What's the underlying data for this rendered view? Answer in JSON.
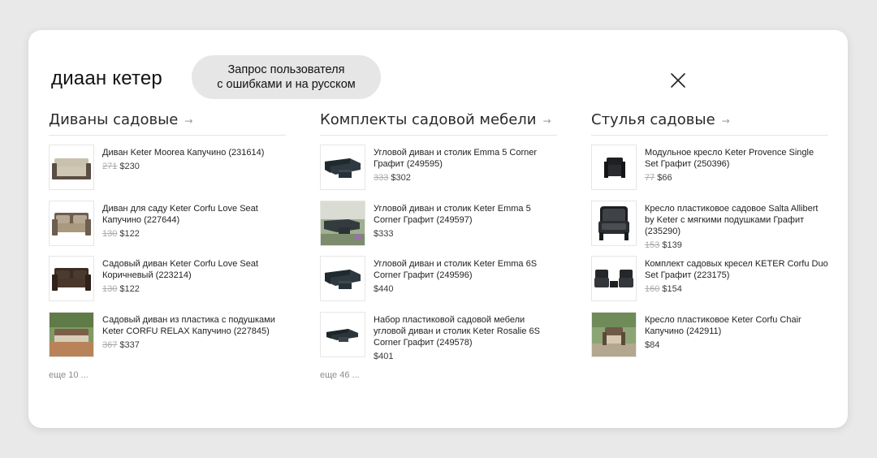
{
  "search": {
    "query": "диаан кетер"
  },
  "annotation": {
    "line1": "Запрос пользователя",
    "line2": "с ошибками и на русском"
  },
  "close_icon": "close-icon",
  "columns": [
    {
      "title": "Диваны садовые",
      "arrow": "→",
      "products": [
        {
          "name": "Диван Keter Moorea Капучино (231614)",
          "old_price": "271",
          "price": "$230",
          "image": "sofa-beige"
        },
        {
          "name": "Диван для саду Keter Corfu Love Seat Капучино (227644)",
          "old_price": "130",
          "price": "$122",
          "image": "sofa-cappuccino"
        },
        {
          "name": "Садовый диван Keter Corfu Love Seat Коричневый (223214)",
          "old_price": "130",
          "price": "$122",
          "image": "sofa-brown"
        },
        {
          "name": "Садовый диван из пластика с подушками Keter CORFU RELAX Капучино (227845)",
          "old_price": "367",
          "price": "$337",
          "image": "sofa-garden-scene"
        }
      ],
      "more": "еще 10 ..."
    },
    {
      "title": "Комплекты садовой мебели",
      "arrow": "→",
      "products": [
        {
          "name": "Угловой диван и столик Emma 5 Corner Графит (249595)",
          "old_price": "333",
          "price": "$302",
          "image": "corner-set-dark"
        },
        {
          "name": "Угловой диван и столик Keter Emma 5 Corner Графит (249597)",
          "old_price": "",
          "price": "$333",
          "image": "corner-set-garden-scene"
        },
        {
          "name": "Угловой диван и столик Keter Emma 6S Corner Графит (249596)",
          "old_price": "",
          "price": "$440",
          "image": "corner-set-dark"
        },
        {
          "name": "Набор пластиковой садовой мебели угловой диван и столик Keter Rosalie 6S Corner Графит (249578)",
          "old_price": "",
          "price": "$401",
          "image": "corner-set-small"
        }
      ],
      "more": "еще 46 ..."
    },
    {
      "title": "Стулья садовые",
      "arrow": "→",
      "products": [
        {
          "name": "Модульное кресло Keter Provence Single Set Графит (250396)",
          "old_price": "77",
          "price": "$66",
          "image": "chair-small-dark"
        },
        {
          "name": "Кресло пластиковое садовое Salta Allibert by Keter с мягкими подушками Графит (235290)",
          "old_price": "153",
          "price": "$139",
          "image": "chair-large-dark"
        },
        {
          "name": "Комплект садовых кресел KETER Corfu Duo Set Графит (223175)",
          "old_price": "160",
          "price": "$154",
          "image": "chair-duo-dark"
        },
        {
          "name": "Кресло пластиковое Keter Corfu Chair Капучино (242911)",
          "old_price": "",
          "price": "$84",
          "image": "chair-garden-scene"
        }
      ],
      "more": ""
    }
  ]
}
